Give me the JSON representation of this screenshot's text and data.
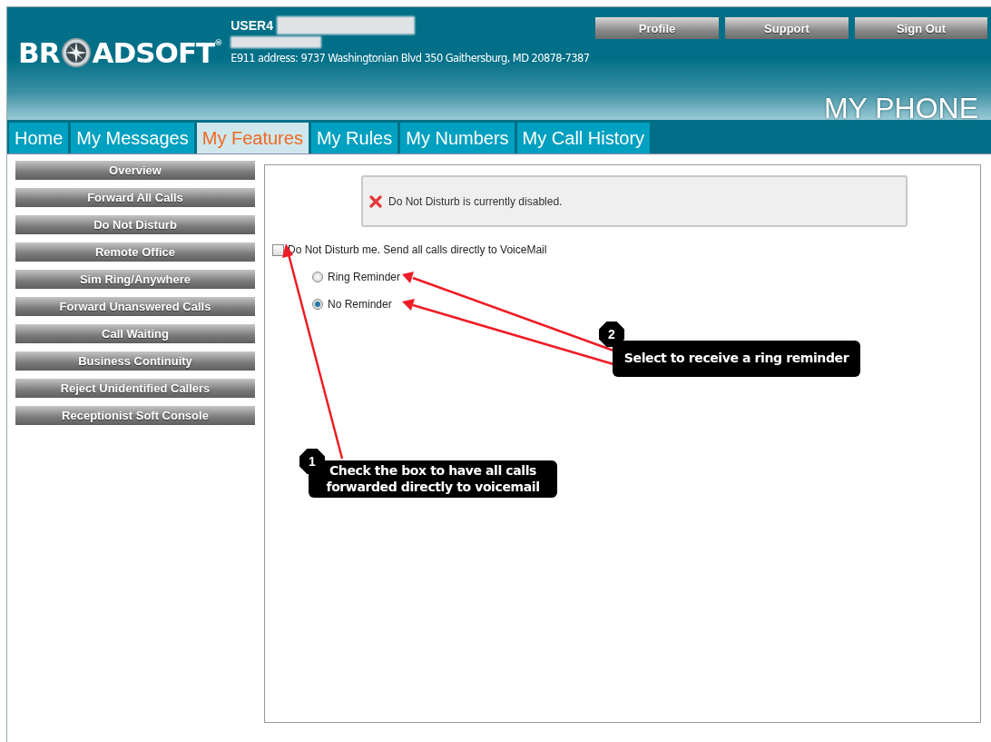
{
  "header": {
    "logo": {
      "left": "BR",
      "right": "ADSOFT",
      "mark": "®"
    },
    "user": "USER4",
    "e911": "E911 address: 9737 Washingtonian Blvd 350 Gaithersburg, MD 20878-7387",
    "buttons": [
      "Profile",
      "Support",
      "Sign Out"
    ],
    "portal_title": "MY PHONE"
  },
  "tabs": [
    {
      "label": "Home",
      "selected": false
    },
    {
      "label": "My Messages",
      "selected": false
    },
    {
      "label": "My Features",
      "selected": true
    },
    {
      "label": "My Rules",
      "selected": false
    },
    {
      "label": "My Numbers",
      "selected": false
    },
    {
      "label": "My Call History",
      "selected": false
    }
  ],
  "sidebar": {
    "items": [
      "Overview",
      "Forward All Calls",
      "Do Not Disturb",
      "Remote Office",
      "Sim Ring/Anywhere",
      "Forward Unanswered Calls",
      "Call Waiting",
      "Business Continuity",
      "Reject Unidentified Callers",
      "Receptionist Soft Console"
    ]
  },
  "status_message": {
    "kind": "error",
    "text": "Do Not Disturb is currently disabled."
  },
  "dnd_checkbox": {
    "label": "Do Not Disturb me. Send all calls directly to VoiceMail",
    "checked": false
  },
  "reminder_options": [
    {
      "label": "Ring Reminder",
      "selected": false
    },
    {
      "label": "No Reminder",
      "selected": true
    }
  ],
  "callouts": [
    {
      "number": "1",
      "text": "Check the box to have all calls forwarded directly to voicemail"
    },
    {
      "number": "2",
      "text": "Select to receive a ring reminder"
    }
  ]
}
